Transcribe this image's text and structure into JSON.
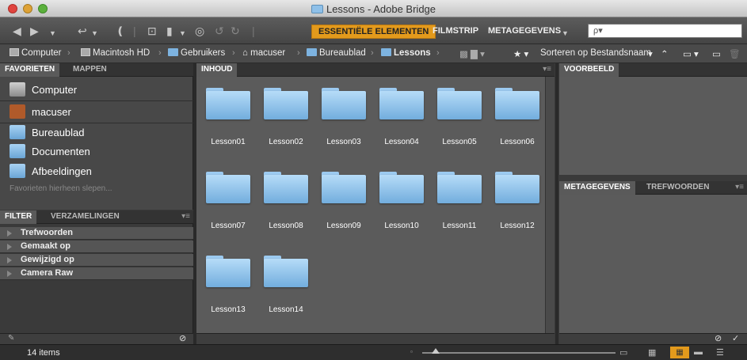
{
  "window": {
    "title": "Lessons - Adobe Bridge"
  },
  "toolbar": {
    "workspaces": [
      "ESSENTIËLE ELEMENTEN",
      "FILMSTRIP",
      "METAGEGEVENS"
    ],
    "search_placeholder": "ρ▾"
  },
  "path": {
    "crumbs": [
      "Computer",
      "Macintosh HD",
      "Gebruikers",
      "macuser",
      "Bureaublad",
      "Lessons"
    ],
    "sort_label": "Sorteren op Bestandsnaam"
  },
  "left": {
    "tabs": [
      "FAVORIETEN",
      "MAPPEN"
    ],
    "favorites": [
      "Computer",
      "macuser",
      "Bureaublad",
      "Documenten",
      "Afbeeldingen"
    ],
    "hint": "Favorieten hierheen slepen...",
    "filter_tabs": [
      "FILTER",
      "VERZAMELINGEN"
    ],
    "filters": [
      "Trefwoorden",
      "Gemaakt op",
      "Gewijzigd op",
      "Camera Raw"
    ]
  },
  "content": {
    "tab": "INHOUD",
    "items": [
      "Lesson01",
      "Lesson02",
      "Lesson03",
      "Lesson04",
      "Lesson05",
      "Lesson06",
      "Lesson07",
      "Lesson08",
      "Lesson09",
      "Lesson10",
      "Lesson11",
      "Lesson12",
      "Lesson13",
      "Lesson14"
    ]
  },
  "right": {
    "preview_tab": "VOORBEELD",
    "meta_tabs": [
      "METAGEGEVENS",
      "TREFWOORDEN"
    ]
  },
  "status": {
    "items": "14 items"
  }
}
